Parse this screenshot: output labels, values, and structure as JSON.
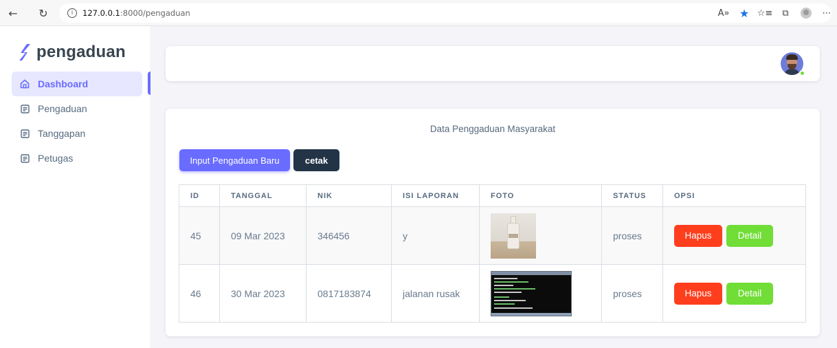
{
  "browser": {
    "url_host": "127.0.0.1",
    "url_path": ":8000/pengaduan",
    "reader_icon_label": "A»"
  },
  "sidebar": {
    "brand": "pengaduan",
    "items": [
      {
        "label": "Dashboard",
        "icon": "home-icon",
        "active": true
      },
      {
        "label": "Pengaduan",
        "icon": "document-icon",
        "active": false
      },
      {
        "label": "Tanggapan",
        "icon": "document-icon",
        "active": false
      },
      {
        "label": "Petugas",
        "icon": "document-icon",
        "active": false
      }
    ]
  },
  "main": {
    "title": "Data Penggaduan Masyarakat",
    "new_button": "Input Pengaduan Baru",
    "print_button": "cetak",
    "table": {
      "headers": [
        "ID",
        "TANGGAL",
        "NIK",
        "ISI LAPORAN",
        "FOTO",
        "STATUS",
        "OPSI"
      ],
      "rows": [
        {
          "id": "45",
          "tanggal": "09 Mar 2023",
          "nik": "346456",
          "isi": "y",
          "foto": "bottle-photo",
          "status": "proses",
          "hapus": "Hapus",
          "detail": "Detail"
        },
        {
          "id": "46",
          "tanggal": "30 Mar 2023",
          "nik": "0817183874",
          "isi": "jalanan rusak",
          "foto": "terminal-screenshot",
          "status": "proses",
          "hapus": "Hapus",
          "detail": "Detail"
        }
      ]
    }
  },
  "colors": {
    "primary": "#696cff",
    "dark": "#233446",
    "danger": "#ff3e1d",
    "success": "#71dd37"
  }
}
